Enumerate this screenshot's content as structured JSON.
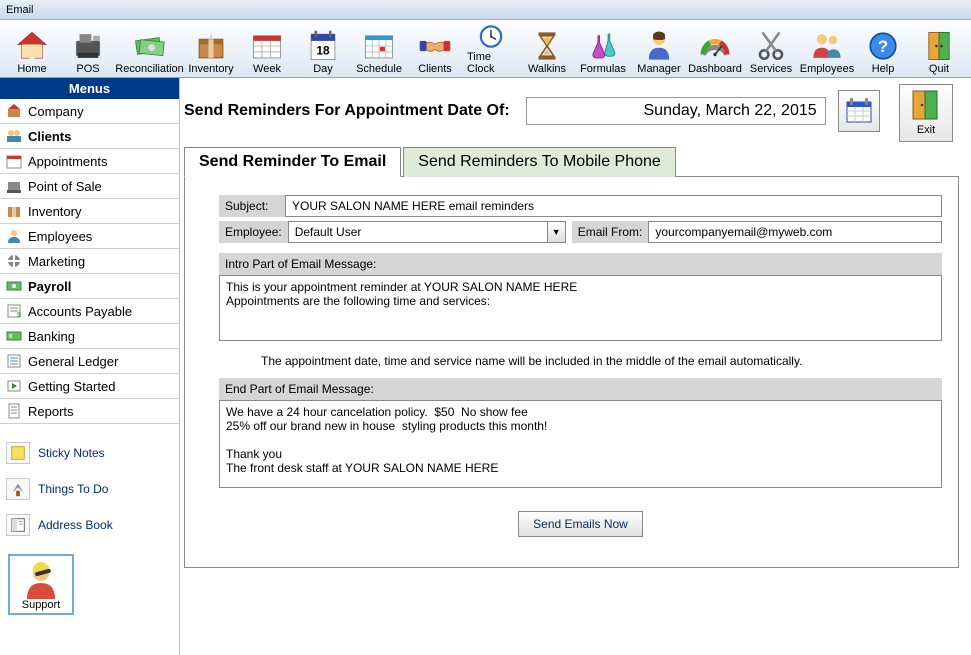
{
  "window": {
    "title": "Email"
  },
  "toolbar": [
    {
      "id": "home",
      "label": "Home"
    },
    {
      "id": "pos",
      "label": "POS"
    },
    {
      "id": "reconciliation",
      "label": "Reconciliation"
    },
    {
      "id": "inventory",
      "label": "Inventory"
    },
    {
      "id": "week",
      "label": "Week"
    },
    {
      "id": "day",
      "label": "Day"
    },
    {
      "id": "schedule",
      "label": "Schedule"
    },
    {
      "id": "clients",
      "label": "Clients"
    },
    {
      "id": "timeclock",
      "label": "Time Clock"
    },
    {
      "id": "walkins",
      "label": "Walkins"
    },
    {
      "id": "formulas",
      "label": "Formulas"
    },
    {
      "id": "manager",
      "label": "Manager"
    },
    {
      "id": "dashboard",
      "label": "Dashboard"
    },
    {
      "id": "services",
      "label": "Services"
    },
    {
      "id": "employees",
      "label": "Employees"
    },
    {
      "id": "help",
      "label": "Help"
    },
    {
      "id": "quit",
      "label": "Quit"
    }
  ],
  "sidebar": {
    "header": "Menus",
    "items": [
      {
        "id": "company",
        "label": "Company"
      },
      {
        "id": "clients",
        "label": "Clients",
        "bold": true
      },
      {
        "id": "appointments",
        "label": "Appointments"
      },
      {
        "id": "pointofsale",
        "label": "Point of Sale"
      },
      {
        "id": "inventory",
        "label": "Inventory"
      },
      {
        "id": "employees",
        "label": "Employees"
      },
      {
        "id": "marketing",
        "label": "Marketing"
      },
      {
        "id": "payroll",
        "label": "Payroll",
        "bold": true
      },
      {
        "id": "ap",
        "label": "Accounts Payable"
      },
      {
        "id": "banking",
        "label": "Banking"
      },
      {
        "id": "gl",
        "label": "General Ledger"
      },
      {
        "id": "getstarted",
        "label": "Getting Started"
      },
      {
        "id": "reports",
        "label": "Reports"
      }
    ],
    "links": [
      {
        "id": "sticky",
        "label": "Sticky Notes"
      },
      {
        "id": "todo",
        "label": "Things To Do"
      },
      {
        "id": "address",
        "label": "Address Book"
      }
    ],
    "support": "Support"
  },
  "main": {
    "header_label": "Send  Reminders For Appointment Date Of:",
    "date_value": "Sunday, March 22, 2015",
    "exit_label": "Exit"
  },
  "tabs": {
    "email": "Send Reminder To Email",
    "phone": "Send Reminders To Mobile Phone"
  },
  "form": {
    "subject_label": "Subject:",
    "subject_value": "YOUR SALON NAME HERE email reminders",
    "employee_label": "Employee:",
    "employee_value": "Default User",
    "emailfrom_label": "Email From:",
    "emailfrom_value": "yourcompanyemail@myweb.com",
    "intro_label": "Intro Part of Email Message:",
    "intro_value": "This is your appointment reminder at YOUR SALON NAME HERE\nAppointments are the following time and services:",
    "note": "The appointment date, time and service name will be included in the middle of the email automatically.",
    "end_label": "End Part of Email Message:",
    "end_value": "We have a 24 hour cancelation policy.  $50  No show fee\n25% off our brand new in house  styling products this month!\n\nThank you\nThe front desk staff at YOUR SALON NAME HERE",
    "send_label": "Send Emails Now"
  },
  "icons": {
    "home": "house",
    "pos": "register",
    "reconciliation": "money",
    "inventory": "box",
    "week": "cal-week",
    "day": "cal-day",
    "schedule": "cal-grid",
    "clients": "handshake",
    "timeclock": "clock",
    "walkins": "hourglass",
    "formulas": "flasks",
    "manager": "person",
    "dashboard": "gauge",
    "services": "scissors",
    "employees": "people",
    "help": "help",
    "quit": "door"
  }
}
